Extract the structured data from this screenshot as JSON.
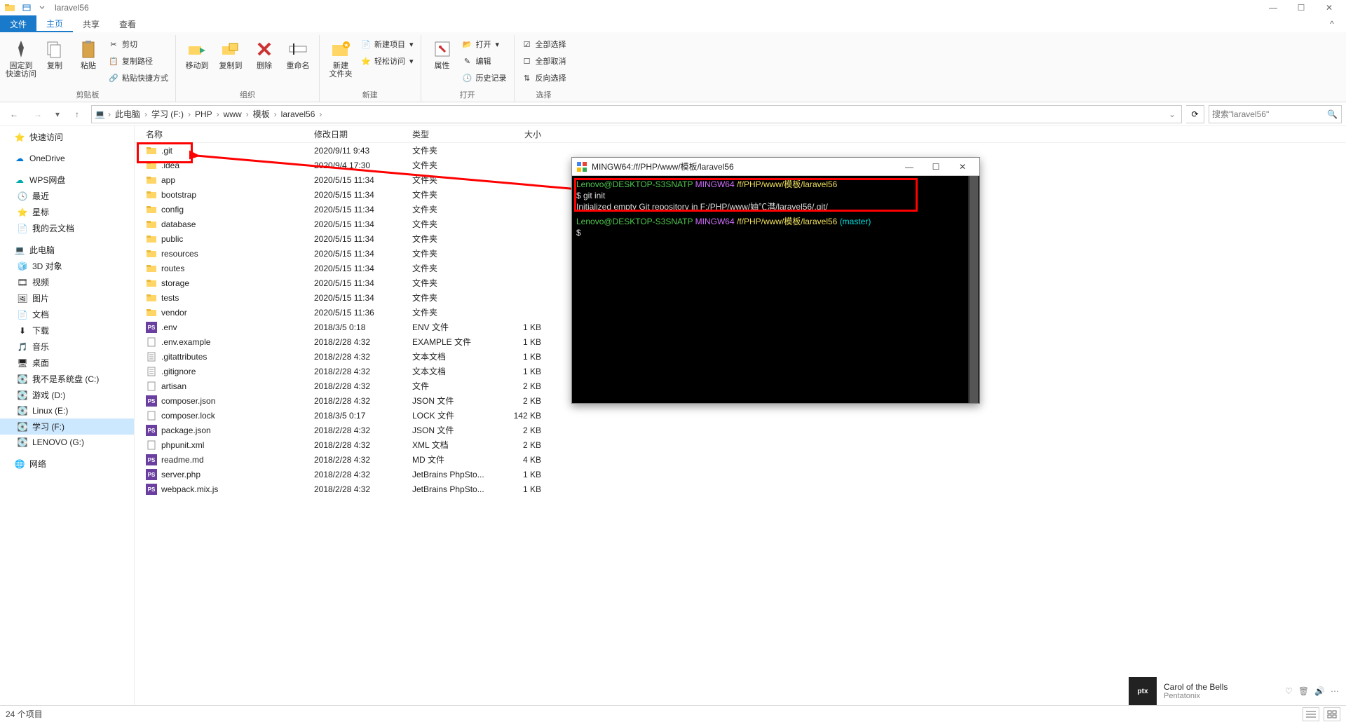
{
  "titlebar": {
    "title": "laravel56"
  },
  "tabs": {
    "file": "文件",
    "home": "主页",
    "share": "共享",
    "view": "查看"
  },
  "ribbon": {
    "clipboard": {
      "label": "剪贴板",
      "pin": "固定到\n快速访问",
      "copy": "复制",
      "paste": "粘贴",
      "cut": "剪切",
      "copy_path": "复制路径",
      "paste_shortcut": "粘贴快捷方式"
    },
    "organize": {
      "label": "组织",
      "move_to": "移动到",
      "copy_to": "复制到",
      "delete": "删除",
      "rename": "重命名"
    },
    "new": {
      "label": "新建",
      "new_folder": "新建\n文件夹",
      "new_item": "新建项目",
      "easy_access": "轻松访问"
    },
    "open": {
      "label": "打开",
      "properties": "属性",
      "open": "打开",
      "edit": "编辑",
      "history": "历史记录"
    },
    "select": {
      "label": "选择",
      "select_all": "全部选择",
      "select_none": "全部取消",
      "invert": "反向选择"
    }
  },
  "breadcrumb": {
    "items": [
      "此电脑",
      "学习 (F:)",
      "PHP",
      "www",
      "模板",
      "laravel56"
    ],
    "search_placeholder": "搜索\"laravel56\""
  },
  "columns": {
    "name": "名称",
    "date": "修改日期",
    "type": "类型",
    "size": "大小"
  },
  "nav": {
    "quick_access": "快速访问",
    "onedrive": "OneDrive",
    "wps": "WPS网盘",
    "recent": "最近",
    "star": "星标",
    "my_docs": "我的云文档",
    "this_pc": "此电脑",
    "objects3d": "3D 对象",
    "videos": "视频",
    "pictures": "图片",
    "documents": "文档",
    "downloads": "下载",
    "music": "音乐",
    "desktop": "桌面",
    "drive_c": "我不是系统盘 (C:)",
    "drive_d": "游戏 (D:)",
    "drive_e": "Linux (E:)",
    "drive_f": "学习 (F:)",
    "drive_g": "LENOVO (G:)",
    "network": "网络"
  },
  "files": [
    {
      "name": ".git",
      "date": "2020/9/11 9:43",
      "type": "文件夹",
      "size": "",
      "icon": "folder",
      "sel": true
    },
    {
      "name": ".idea",
      "date": "2020/9/4 17:30",
      "type": "文件夹",
      "size": "",
      "icon": "folder"
    },
    {
      "name": "app",
      "date": "2020/5/15 11:34",
      "type": "文件夹",
      "size": "",
      "icon": "folder"
    },
    {
      "name": "bootstrap",
      "date": "2020/5/15 11:34",
      "type": "文件夹",
      "size": "",
      "icon": "folder"
    },
    {
      "name": "config",
      "date": "2020/5/15 11:34",
      "type": "文件夹",
      "size": "",
      "icon": "folder"
    },
    {
      "name": "database",
      "date": "2020/5/15 11:34",
      "type": "文件夹",
      "size": "",
      "icon": "folder"
    },
    {
      "name": "public",
      "date": "2020/5/15 11:34",
      "type": "文件夹",
      "size": "",
      "icon": "folder"
    },
    {
      "name": "resources",
      "date": "2020/5/15 11:34",
      "type": "文件夹",
      "size": "",
      "icon": "folder"
    },
    {
      "name": "routes",
      "date": "2020/5/15 11:34",
      "type": "文件夹",
      "size": "",
      "icon": "folder"
    },
    {
      "name": "storage",
      "date": "2020/5/15 11:34",
      "type": "文件夹",
      "size": "",
      "icon": "folder"
    },
    {
      "name": "tests",
      "date": "2020/5/15 11:34",
      "type": "文件夹",
      "size": "",
      "icon": "folder"
    },
    {
      "name": "vendor",
      "date": "2020/5/15 11:36",
      "type": "文件夹",
      "size": "",
      "icon": "folder"
    },
    {
      "name": ".env",
      "date": "2018/3/5 0:18",
      "type": "ENV 文件",
      "size": "1 KB",
      "icon": "jb"
    },
    {
      "name": ".env.example",
      "date": "2018/2/28 4:32",
      "type": "EXAMPLE 文件",
      "size": "1 KB",
      "icon": "file"
    },
    {
      "name": ".gitattributes",
      "date": "2018/2/28 4:32",
      "type": "文本文档",
      "size": "1 KB",
      "icon": "txt"
    },
    {
      "name": ".gitignore",
      "date": "2018/2/28 4:32",
      "type": "文本文档",
      "size": "1 KB",
      "icon": "txt"
    },
    {
      "name": "artisan",
      "date": "2018/2/28 4:32",
      "type": "文件",
      "size": "2 KB",
      "icon": "file"
    },
    {
      "name": "composer.json",
      "date": "2018/2/28 4:32",
      "type": "JSON 文件",
      "size": "2 KB",
      "icon": "jb"
    },
    {
      "name": "composer.lock",
      "date": "2018/3/5 0:17",
      "type": "LOCK 文件",
      "size": "142 KB",
      "icon": "file"
    },
    {
      "name": "package.json",
      "date": "2018/2/28 4:32",
      "type": "JSON 文件",
      "size": "2 KB",
      "icon": "jb"
    },
    {
      "name": "phpunit.xml",
      "date": "2018/2/28 4:32",
      "type": "XML 文档",
      "size": "2 KB",
      "icon": "file"
    },
    {
      "name": "readme.md",
      "date": "2018/2/28 4:32",
      "type": "MD 文件",
      "size": "4 KB",
      "icon": "jb"
    },
    {
      "name": "server.php",
      "date": "2018/2/28 4:32",
      "type": "JetBrains PhpSto...",
      "size": "1 KB",
      "icon": "jb"
    },
    {
      "name": "webpack.mix.js",
      "date": "2018/2/28 4:32",
      "type": "JetBrains PhpSto...",
      "size": "1 KB",
      "icon": "jb"
    }
  ],
  "status": {
    "item_count": "24 个项目"
  },
  "terminal": {
    "title": "MINGW64:/f/PHP/www/模板/laravel56",
    "line1_user": "Lenovo@DESKTOP-S3SNATP",
    "line1_env": "MINGW64",
    "line1_path": "/f/PHP/www/模板/laravel56",
    "cmd": "$ git init",
    "output": "Initialized empty Git repository in F:/PHP/www/妯℃澘/laravel56/.git/",
    "line2_user": "Lenovo@DESKTOP-S3SNATP",
    "line2_env": "MINGW64",
    "line2_path": "/f/PHP/www/模板/laravel56",
    "line2_branch": "(master)",
    "prompt": "$"
  },
  "music": {
    "title": "Carol of the Bells",
    "artist": "Pentatonix",
    "art": "ptx"
  }
}
